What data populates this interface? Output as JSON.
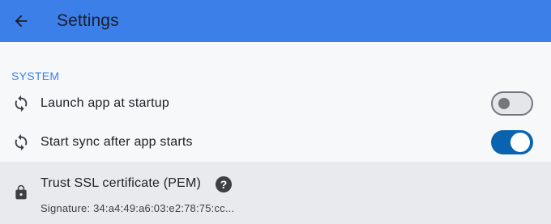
{
  "appbar": {
    "title": "Settings",
    "back_icon": "arrow-back-icon",
    "background": "#3d7fe8"
  },
  "section": {
    "header": "SYSTEM",
    "accent": "#3d7fe8"
  },
  "settings": [
    {
      "icon": "sync-icon",
      "label": "Launch app at startup",
      "enabled": false
    },
    {
      "icon": "sync-icon",
      "label": "Start sync after app starts",
      "enabled": true
    }
  ],
  "certificate": {
    "icon": "lock-icon",
    "title": "Trust SSL certificate (PEM)",
    "help_icon": "help-icon",
    "help_glyph": "?",
    "signature": "Signature: 34:a4:49:a6:03:e2:78:75:cc..."
  },
  "colors": {
    "toggle_on": "#0a63b0",
    "toggle_off_track": "#e4e6ea",
    "toggle_off_border": "#74777c",
    "selected_row": "#e9eaee"
  }
}
